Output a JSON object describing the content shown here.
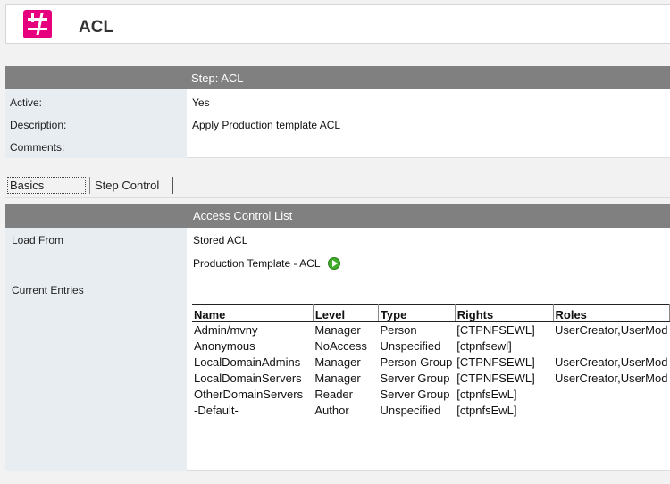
{
  "app": {
    "title": "ACL",
    "brand_color": "#e6007e"
  },
  "step": {
    "header": "Step:  ACL",
    "fields": [
      {
        "label": "Active:",
        "value": "Yes"
      },
      {
        "label": "Description:",
        "value": "Apply Production template ACL"
      },
      {
        "label": "Comments:",
        "value": ""
      }
    ]
  },
  "tabs": [
    {
      "label": "Basics",
      "active": true
    },
    {
      "label": "Step Control",
      "active": false
    }
  ],
  "acl": {
    "header": "Access Control List",
    "load_from_label": "Load From",
    "load_from_value": "Stored ACL",
    "template_name": "Production Template - ACL",
    "template_icon": "run-icon",
    "current_entries_label": "Current Entries",
    "columns": [
      "Name",
      "Level",
      "Type",
      "Rights",
      "Roles"
    ],
    "rows": [
      [
        "Admin/mvny",
        "Manager",
        "Person",
        "[CTPNFSEWL]",
        "UserCreator,UserMod"
      ],
      [
        "Anonymous",
        "NoAccess",
        "Unspecified",
        "[ctpnfsewl]",
        ""
      ],
      [
        "LocalDomainAdmins",
        "Manager",
        "Person Group",
        "[CTPNFSEWL]",
        "UserCreator,UserMod"
      ],
      [
        "LocalDomainServers",
        "Manager",
        "Server Group",
        "[CTPNFSEWL]",
        "UserCreator,UserMod"
      ],
      [
        "OtherDomainServers",
        "Reader",
        "Server Group",
        "[ctpnfsEwL]",
        ""
      ],
      [
        "-Default-",
        "Author",
        "Unspecified",
        "[ctpnfsEwL]",
        ""
      ]
    ]
  }
}
